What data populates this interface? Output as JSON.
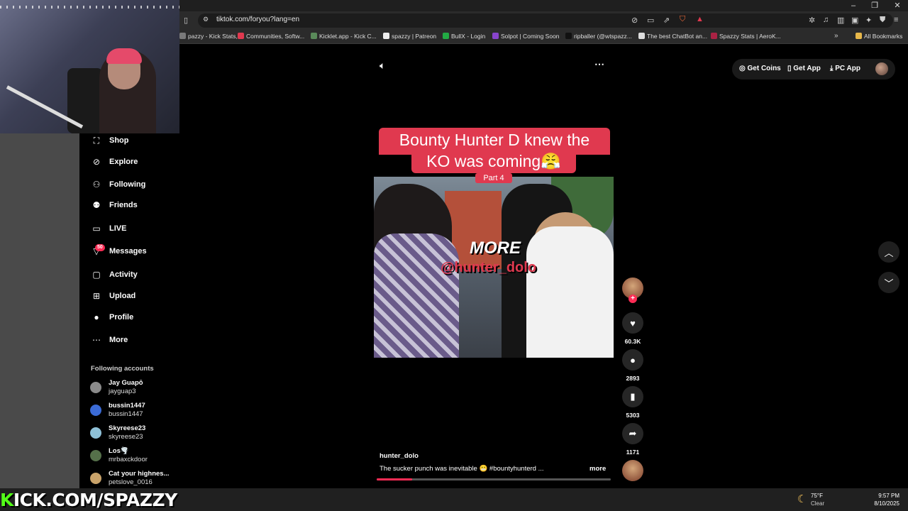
{
  "browser": {
    "url": "tiktok.com/foryou?lang=en",
    "bookmarks": [
      {
        "label": "pazzy - Kick Stats,...",
        "color": "#7a7a7a"
      },
      {
        "label": "Communities, Softw...",
        "color": "#e0394f"
      },
      {
        "label": "Kicklet.app - Kick C...",
        "color": "#5a8a5a"
      },
      {
        "label": "spazzy | Patreon",
        "color": "#eeeeee"
      },
      {
        "label": "BullX - Login",
        "color": "#22aa44"
      },
      {
        "label": "Solpot | Coming Soon",
        "color": "#8844cc"
      },
      {
        "label": "ripballer (@wtspazz...",
        "color": "#111111"
      },
      {
        "label": "The best ChatBot an...",
        "color": "#dddddd"
      },
      {
        "label": "Spazzy Stats | AeroK...",
        "color": "#aa2244"
      }
    ],
    "all_bookmarks": "All Bookmarks"
  },
  "sidebar": {
    "items": [
      {
        "label": "Shop",
        "icon": "shop-bag-icon",
        "glyph": "⛶"
      },
      {
        "label": "Explore",
        "icon": "compass-icon",
        "glyph": "⊘"
      },
      {
        "label": "Following",
        "icon": "following-person-icon",
        "glyph": "⚇"
      },
      {
        "label": "Friends",
        "icon": "friends-icon",
        "glyph": "⚉"
      },
      {
        "label": "LIVE",
        "icon": "live-tv-icon",
        "glyph": "▭"
      },
      {
        "label": "Messages",
        "icon": "send-icon",
        "glyph": "▽"
      },
      {
        "label": "Activity",
        "icon": "activity-icon",
        "glyph": "▢"
      },
      {
        "label": "Upload",
        "icon": "upload-plus-icon",
        "glyph": "⊞"
      },
      {
        "label": "Profile",
        "icon": "profile-avatar-icon",
        "glyph": "●"
      },
      {
        "label": "More",
        "icon": "more-dots-icon",
        "glyph": "⋯"
      }
    ],
    "messages_badge": "50",
    "following_header": "Following accounts",
    "accounts": [
      {
        "name": "Jay Guapō",
        "handle": "jayguap3",
        "color": "#8a8a8a"
      },
      {
        "name": "bussin1447",
        "handle": "bussin1447",
        "color": "#3b6bd6"
      },
      {
        "name": "Skyreese23",
        "handle": "skyreese23",
        "color": "#8fc1d8"
      },
      {
        "name": "Los🌪️",
        "handle": "mrbaxckdoor",
        "color": "#55704a"
      },
      {
        "name": "Cat your highnes...",
        "handle": "petslove_0016",
        "color": "#c9a36a"
      }
    ]
  },
  "top_actions": {
    "get_coins": "Get Coins",
    "get_app": "Get App",
    "pc_app": "PC App"
  },
  "video": {
    "caption_line1": "Bounty Hunter D knew the",
    "caption_line2": "KO was coming😤",
    "part_tag": "Part 4",
    "overlay_more": "MORE",
    "overlay_handle": "@hunter_dolo",
    "author": "hunter_dolo",
    "description": "The sucker punch was inevitable 😬 #bountyhunterd ...",
    "more_link": "more",
    "progress": 0.15
  },
  "rail": {
    "likes": "60.3K",
    "comments": "2893",
    "bookmarks": "5303",
    "shares": "1171"
  },
  "overlay": {
    "kick_prefix": "K",
    "kick_rest": "ICK.COM/SPAZZY"
  },
  "taskbar": {
    "temp": "75°F",
    "condition": "Clear",
    "time": "9:57 PM",
    "date": "8/10/2025"
  }
}
